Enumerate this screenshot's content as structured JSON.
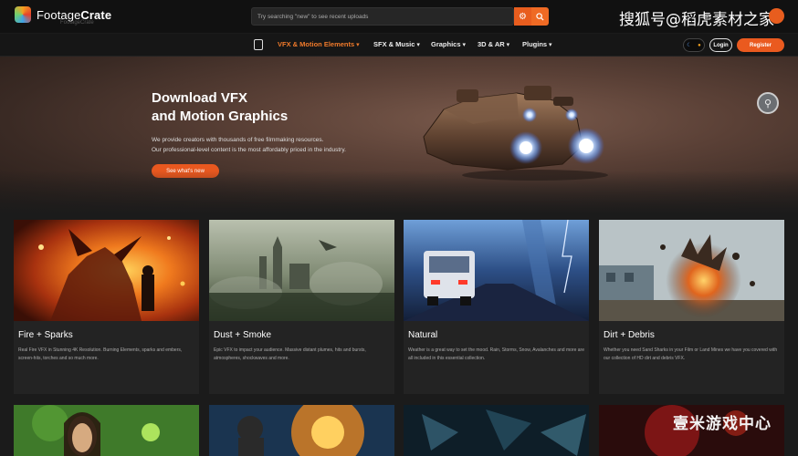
{
  "header": {
    "logo_regular": "Footage",
    "logo_bold": "Crate",
    "logo_sub": "FootageCrate",
    "search_placeholder": "Try searching \"new\" to see recent uploads",
    "watermark": "搜狐号@稻虎素材之家"
  },
  "nav": {
    "items": [
      {
        "label": "VFX & Motion Elements",
        "active": true
      },
      {
        "label": "SFX & Music",
        "active": false
      },
      {
        "label": "Graphics",
        "active": false
      },
      {
        "label": "3D & AR",
        "active": false
      },
      {
        "label": "Plugins",
        "active": false
      }
    ],
    "login_label": "Login",
    "register_label": "Register"
  },
  "hero": {
    "title_line1": "Download VFX",
    "title_line2": "and Motion Graphics",
    "desc_line1": "We provide creators with thousands of free filmmaking resources.",
    "desc_line2": "Our professional-level content is the most affordably priced in the industry.",
    "cta_label": "See what's new"
  },
  "cards": [
    {
      "title": "Fire + Sparks",
      "desc": "Real Fire VFX in Stunning 4K Resolution. Burning Elements, sparks and embers, screen-hits, torches and so much more."
    },
    {
      "title": "Dust + Smoke",
      "desc": "Epic VFX to impact your audience. Massive distant plumes, hits and bursts, atmospheres, shockwaves and more."
    },
    {
      "title": "Natural",
      "desc": "Weather is a great way to set the mood. Rain, Storms, Snow, Avalanches and more are all included in this essential collection."
    },
    {
      "title": "Dirt + Debris",
      "desc": "Whether you need Sand Sharks in your Film or Land Mines we have you covered with our collection of HD dirt and debris VFX."
    }
  ],
  "footer_watermark": "壹米游戏中心",
  "colors": {
    "accent": "#e85d1e",
    "background": "#1b1b1b",
    "card": "#232323"
  }
}
